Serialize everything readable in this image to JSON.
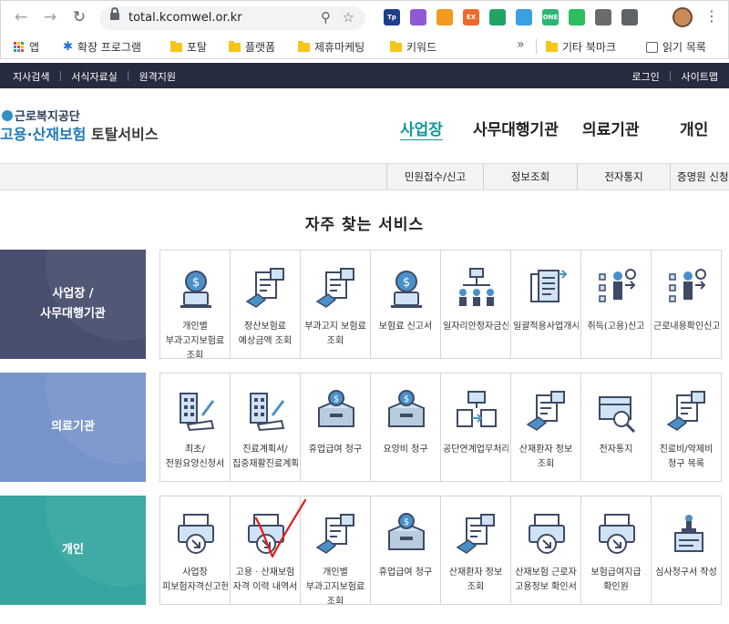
{
  "browser": {
    "url": "total.kcomwel.or.kr",
    "bookmarks": [
      {
        "label": "앱",
        "icon": "apps-grid-icon"
      },
      {
        "label": "확장 프로그램",
        "icon": "puzzle-icon"
      },
      {
        "label": "포탈",
        "icon": "folder-icon"
      },
      {
        "label": "플랫폼",
        "icon": "folder-icon"
      },
      {
        "label": "제휴마케팅",
        "icon": "folder-icon"
      },
      {
        "label": "키워드",
        "icon": "folder-icon"
      },
      {
        "label": "기타 북마크",
        "icon": "folder-icon"
      },
      {
        "label": "읽기 목록",
        "icon": "reading-list-icon"
      }
    ],
    "extensions": [
      {
        "name": "tistory-ext-icon",
        "color": "#1d3f8c",
        "text": "Tp"
      },
      {
        "name": "feather-ext-icon",
        "color": "#8e59d6",
        "text": ""
      },
      {
        "name": "chart-ext-icon",
        "color": "#f29a1f",
        "text": ""
      },
      {
        "name": "ex-ext-icon",
        "color": "#ee6a2b",
        "text": "EX"
      },
      {
        "name": "drive-ext-icon",
        "color": "#1fa463",
        "text": ""
      },
      {
        "name": "cloud-ext-icon",
        "color": "#3aa0e0",
        "text": ""
      },
      {
        "name": "one-ext-icon",
        "color": "#2bb673",
        "text": "ONE"
      },
      {
        "name": "evernote-ext-icon",
        "color": "#2dbe60",
        "text": ""
      },
      {
        "name": "frame-ext-icon",
        "color": "#6b6b6b",
        "text": ""
      },
      {
        "name": "puzzle-ext-icon",
        "color": "#5f6368",
        "text": ""
      }
    ]
  },
  "site": {
    "utility_left": [
      "지사검색",
      "서식자료실",
      "원격지원"
    ],
    "utility_right": [
      "로그인",
      "사이트맵"
    ],
    "logo_agency": "근로복지공단",
    "logo_service_a": "고용·산재보험",
    "logo_service_b": "토탈서비스",
    "main_nav": [
      "사업장",
      "사무대행기관",
      "의료기관",
      "개인"
    ],
    "sub_nav": [
      "민원접수/신고",
      "정보조회",
      "전자통지",
      "증명원 신청"
    ],
    "section_title": "자주 찾는 서비스",
    "rows": [
      {
        "category": [
          "사업장 /",
          "사무대행기관"
        ],
        "color": "#474e6e",
        "tiles": [
          {
            "label": "개인별 부과고지보험료 조회",
            "icon": "money-monitor-icon"
          },
          {
            "label": "정산보험료 예상금액 조회",
            "icon": "document-search-icon"
          },
          {
            "label": "부과고지 보험료 조회",
            "icon": "document-search-icon"
          },
          {
            "label": "보험료 신고서",
            "icon": "money-monitor-icon"
          },
          {
            "label": "일자리안정자금신청확인안내",
            "icon": "org-chart-icon"
          },
          {
            "label": "일괄적용사업개시신고",
            "icon": "documents-stack-icon"
          },
          {
            "label": "취득(고용)신고",
            "icon": "person-list-icon"
          },
          {
            "label": "근로내용확인신고",
            "icon": "person-list-icon"
          }
        ]
      },
      {
        "category": [
          "의료기관"
        ],
        "color": "#7794c9",
        "tiles": [
          {
            "label": "최초/전원요양신청서",
            "icon": "building-pen-icon"
          },
          {
            "label": "진료계획서/집중재활진료계획서",
            "icon": "building-pen-icon"
          },
          {
            "label": "휴업급여 청구",
            "icon": "money-box-icon"
          },
          {
            "label": "요양비 청구",
            "icon": "money-box-icon"
          },
          {
            "label": "공단연계업무처리",
            "icon": "folders-exchange-icon"
          },
          {
            "label": "산재환자 정보 조회",
            "icon": "document-search-icon"
          },
          {
            "label": "전자통지",
            "icon": "box-search-icon"
          },
          {
            "label": "진료비/약제비 청구 목록",
            "icon": "document-search-icon"
          }
        ]
      },
      {
        "category": [
          "개인"
        ],
        "color": "#35a59f",
        "tiles": [
          {
            "label": "사업장 피보험자격신고현황",
            "icon": "printer-arrow-icon"
          },
          {
            "label": "고용 · 산재보험 자격 이력 내역서",
            "icon": "printer-arrow-icon"
          },
          {
            "label": "개인별 부과고지보험료 조회",
            "icon": "document-search-icon"
          },
          {
            "label": "휴업급여 청구",
            "icon": "money-box-icon"
          },
          {
            "label": "산재환자 정보 조회",
            "icon": "document-search-icon"
          },
          {
            "label": "산재보험 근로자 고용정보 확인서",
            "icon": "printer-arrow-icon"
          },
          {
            "label": "보험급여지급 확인원",
            "icon": "printer-arrow-icon"
          },
          {
            "label": "심사청구서 작성",
            "icon": "document-stamp-icon"
          }
        ]
      }
    ]
  }
}
